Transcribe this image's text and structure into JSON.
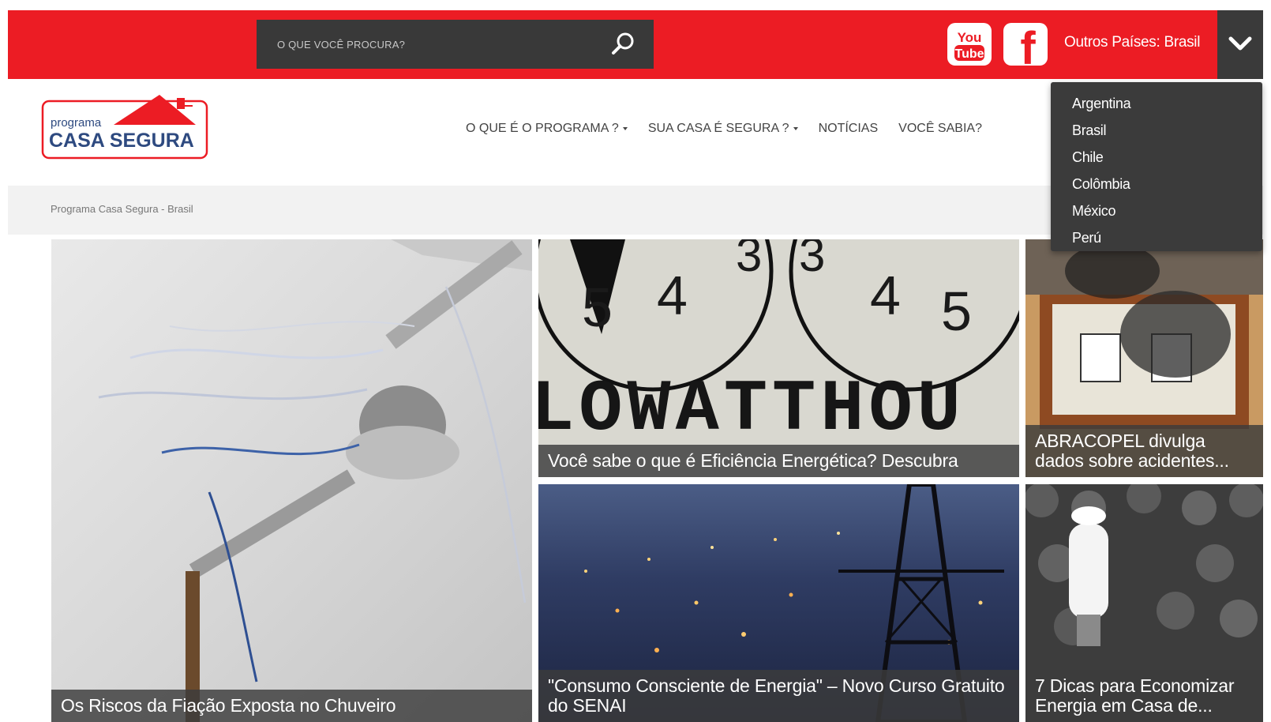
{
  "header": {
    "search": {
      "placeholder": "O QUE VOCÊ PROCURA?"
    },
    "social": {
      "youtube": {
        "line1": "You",
        "line2": "Tube"
      },
      "facebook": {
        "glyph": "f"
      }
    },
    "country_label": "Outros Países: Brasil"
  },
  "logo": {
    "small_text": "programa",
    "big_text": "CASA SEGURA"
  },
  "nav": {
    "items": [
      {
        "label": "O QUE É O PROGRAMA ?",
        "has_caret": true
      },
      {
        "label": "SUA CASA É SEGURA ?",
        "has_caret": true
      },
      {
        "label": "NOTÍCIAS",
        "has_caret": false
      },
      {
        "label": "VOCÊ SABIA?",
        "has_caret": false
      }
    ]
  },
  "breadcrumb": "Programa Casa Segura - Brasil",
  "country_menu": {
    "items": [
      "Argentina",
      "Brasil",
      "Chile",
      "Colômbia",
      "México",
      "Perú"
    ]
  },
  "tiles": [
    {
      "caption": "Os Riscos da Fiação Exposta no Chuveiro"
    },
    {
      "caption": "Você sabe o que é Eficiência Energética? Descubra",
      "meter_text": "LOWATTHOU",
      "digits": [
        "5",
        "4",
        "3",
        "3",
        "4",
        "5"
      ]
    },
    {
      "caption": "ABRACOPEL divulga dados sobre acidentes..."
    },
    {
      "caption": "\"Consumo Consciente de Energia\" – Novo Curso Gratuito do SENAI"
    },
    {
      "caption": "7 Dicas para Economizar Energia em Casa de..."
    }
  ],
  "colors": {
    "brand_red": "#ec1c24",
    "dark_gray": "#3a3a3a",
    "menu_bg": "#3b3b3b"
  }
}
